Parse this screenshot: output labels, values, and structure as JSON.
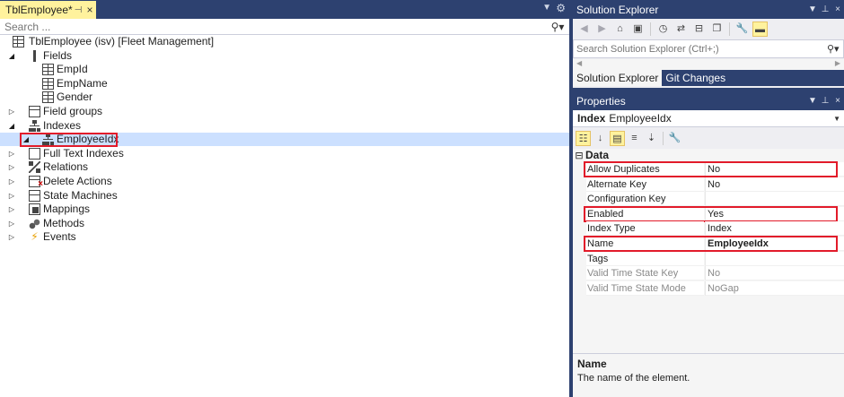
{
  "document": {
    "tab_title": "TblEmployee*",
    "search_placeholder": "Search ..."
  },
  "tree": [
    {
      "label": "TblEmployee (isv) [Fleet Management]",
      "icon": "table-icon",
      "expander": "",
      "level": 0
    },
    {
      "label": "Fields",
      "icon": "fields-icon",
      "expander": "expanded",
      "level": 1
    },
    {
      "label": "EmpId",
      "icon": "field-icon",
      "expander": "",
      "level": 2
    },
    {
      "label": "EmpName",
      "icon": "field-icon",
      "expander": "",
      "level": 2
    },
    {
      "label": "Gender",
      "icon": "field-icon",
      "expander": "",
      "level": 2
    },
    {
      "label": "Field groups",
      "icon": "field-group-icon",
      "expander": "collapsed",
      "level": 1
    },
    {
      "label": "Indexes",
      "icon": "index-icon",
      "expander": "expanded",
      "level": 1
    },
    {
      "label": "EmployeeIdx",
      "icon": "index-icon",
      "expander": "expanded",
      "level": 2,
      "selected": true,
      "highlighted": true
    },
    {
      "label": "Full Text Indexes",
      "icon": "full-text-index-icon",
      "expander": "collapsed",
      "level": 1
    },
    {
      "label": "Relations",
      "icon": "relations-icon",
      "expander": "collapsed",
      "level": 1
    },
    {
      "label": "Delete Actions",
      "icon": "delete-actions-icon",
      "expander": "collapsed",
      "level": 1
    },
    {
      "label": "State Machines",
      "icon": "state-machines-icon",
      "expander": "collapsed",
      "level": 1
    },
    {
      "label": "Mappings",
      "icon": "mappings-icon",
      "expander": "collapsed",
      "level": 1
    },
    {
      "label": "Methods",
      "icon": "methods-icon",
      "expander": "collapsed",
      "level": 1
    },
    {
      "label": "Events",
      "icon": "events-icon",
      "expander": "collapsed",
      "level": 1
    }
  ],
  "solution_explorer": {
    "title": "Solution Explorer",
    "search_placeholder": "Search Solution Explorer (Ctrl+;)",
    "tabs": [
      "Solution Explorer",
      "Git Changes"
    ],
    "active_tab": "Solution Explorer"
  },
  "properties": {
    "title": "Properties",
    "object_type": "Index",
    "object_name": "EmployeeIdx",
    "category": "Data",
    "rows": [
      {
        "name": "Allow Duplicates",
        "value": "No",
        "highlighted": true
      },
      {
        "name": "Alternate Key",
        "value": "No"
      },
      {
        "name": "Configuration Key",
        "value": ""
      },
      {
        "name": "Enabled",
        "value": "Yes",
        "highlighted": true
      },
      {
        "name": "Index Type",
        "value": "Index"
      },
      {
        "name": "Name",
        "value": "EmployeeIdx",
        "highlighted": true,
        "bold": true
      },
      {
        "name": "Tags",
        "value": ""
      },
      {
        "name": "Valid Time State Key",
        "value": "No",
        "readonly": true
      },
      {
        "name": "Valid Time State Mode",
        "value": "NoGap",
        "readonly": true
      }
    ],
    "description_title": "Name",
    "description_text": "The name of the element."
  },
  "colors": {
    "chrome": "#2d4170",
    "active_tab": "#fff29d",
    "selection": "#cce0ff",
    "highlight_box": "#e21b2a"
  }
}
